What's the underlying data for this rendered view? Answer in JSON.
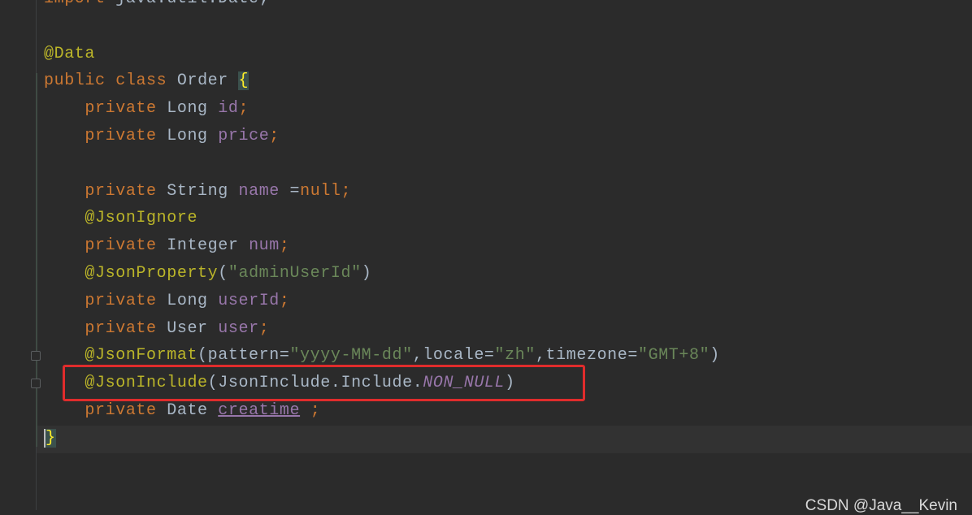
{
  "editor": {
    "lines": {
      "l0": {
        "kw": "import",
        "rest": " java.util.Date;"
      },
      "l2": {
        "ann": "@Data"
      },
      "l3": {
        "kw1": "public",
        "kw2": "class",
        "name": "Order",
        "brace": "{"
      },
      "l4": {
        "kw": "private",
        "type": "Long",
        "field": "id",
        "end": ";"
      },
      "l5": {
        "kw": "private",
        "type": "Long",
        "field": "price",
        "end": ";"
      },
      "l7": {
        "kw": "private",
        "type": "String",
        "field": "name",
        "op": " =",
        "val": "null",
        "end": ";"
      },
      "l8": {
        "ann": "@JsonIgnore"
      },
      "l9": {
        "kw": "private",
        "type": "Integer",
        "field": "num",
        "end": ";"
      },
      "l10": {
        "ann": "@JsonProperty",
        "open": "(",
        "str": "\"adminUserId\"",
        "close": ")"
      },
      "l11": {
        "kw": "private",
        "type": "Long",
        "field": "userId",
        "end": ";"
      },
      "l12": {
        "kw": "private",
        "type": "User",
        "field": "user",
        "end": ";"
      },
      "l13": {
        "ann": "@JsonFormat",
        "p1": "(pattern=",
        "s1": "\"yyyy-MM-dd\"",
        "p2": ",locale=",
        "s2": "\"zh\"",
        "p3": ",timezone=",
        "s3": "\"GMT+8\"",
        "close": ")"
      },
      "l14": {
        "ann": "@JsonInclude",
        "open": "(JsonInclude.Include.",
        "const": "NON_NULL",
        "close": ")"
      },
      "l15": {
        "kw": "private",
        "type": "Date",
        "field": "creatime",
        "end": " ;"
      },
      "l16": {
        "brace": "}"
      }
    }
  },
  "watermark": "CSDN @Java__Kevin",
  "colors": {
    "background": "#2b2b2b",
    "keyword": "#cc7832",
    "annotation": "#bbb529",
    "field": "#9876aa",
    "string": "#6a8759",
    "default_text": "#a9b7c6",
    "highlight_box": "#e02c2c"
  }
}
